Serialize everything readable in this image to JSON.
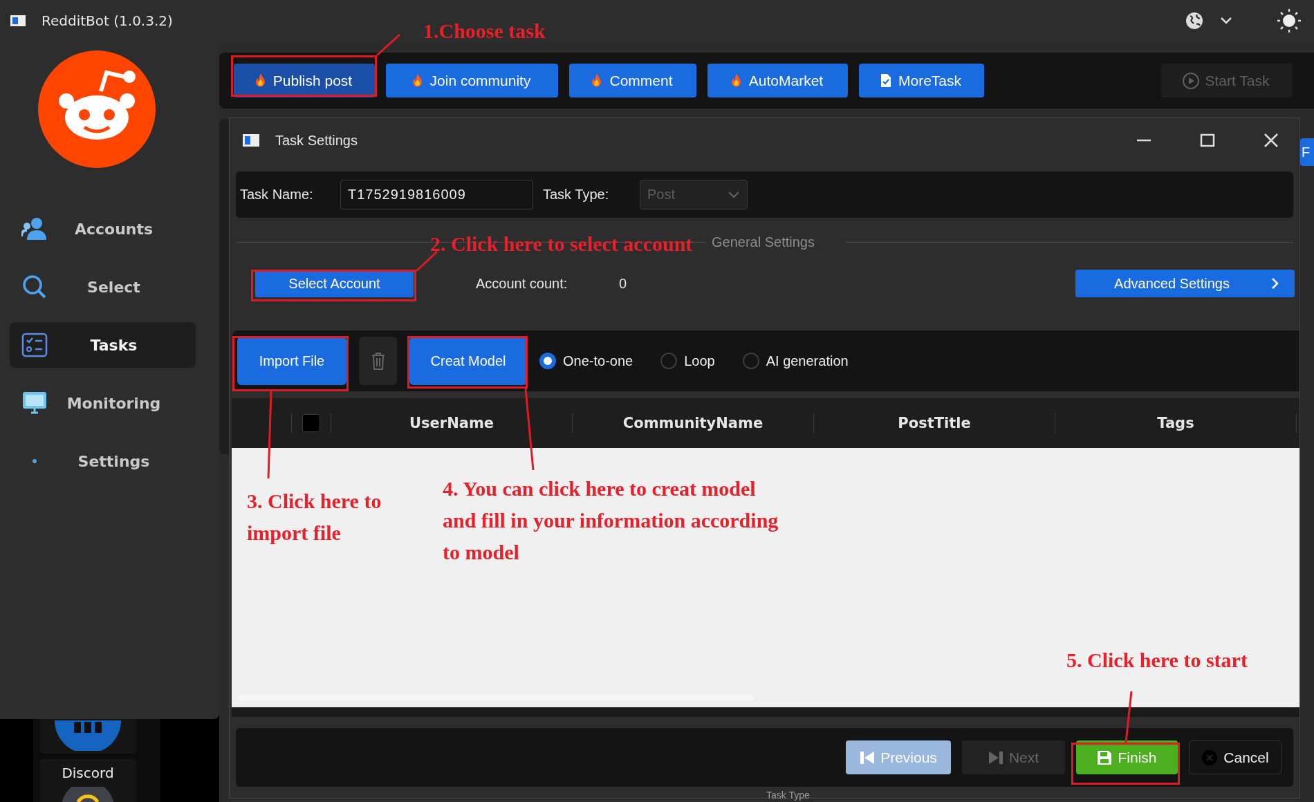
{
  "window": {
    "title": "RedditBot (1.0.3.2)"
  },
  "sidebar": {
    "items": [
      {
        "label": "Accounts",
        "selected": false
      },
      {
        "label": "Select",
        "selected": false
      },
      {
        "label": "Tasks",
        "selected": true
      },
      {
        "label": "Monitoring",
        "selected": false
      },
      {
        "label": "Settings",
        "selected": false
      }
    ]
  },
  "background_panel": {
    "discord_label": "Discord",
    "side_button": "F",
    "caption": "Task Type"
  },
  "task_toolbar": {
    "tasks": [
      {
        "label": "Publish post",
        "kind": "hot",
        "selected": true
      },
      {
        "label": "Join community",
        "kind": "hot",
        "selected": false
      },
      {
        "label": "Comment",
        "kind": "hot",
        "selected": false
      },
      {
        "label": "AutoMarket",
        "kind": "hot",
        "selected": false
      },
      {
        "label": "MoreTask",
        "kind": "doc",
        "selected": false
      }
    ],
    "start_button": {
      "label": "Start Task",
      "disabled": true
    }
  },
  "dialog": {
    "title": "Task Settings",
    "task_name_label": "Task Name:",
    "task_name": "T1752919816009",
    "task_type_label": "Task Type:",
    "task_type": {
      "value": "Post",
      "disabled": true
    },
    "section_title": "General Settings",
    "select_account": "Select Account",
    "account_count_label": "Account count:",
    "account_count": "0",
    "advanced_settings": "Advanced Settings",
    "import_file": "Import File",
    "creat_model": "Creat Model",
    "modes": [
      {
        "label": "One-to-one",
        "selected": true
      },
      {
        "label": "Loop",
        "selected": false
      },
      {
        "label": "AI generation",
        "selected": false
      }
    ],
    "table": {
      "header_checked": false,
      "columns": [
        "UserName",
        "CommunityName",
        "PostTitle",
        "Tags"
      ]
    },
    "buttons": [
      {
        "label": "Previous",
        "kind": "previous",
        "disabled": true
      },
      {
        "label": "Next",
        "kind": "next",
        "disabled": true
      },
      {
        "label": "Finish",
        "kind": "finish",
        "disabled": false
      },
      {
        "label": "Cancel",
        "kind": "cancel",
        "disabled": false
      }
    ]
  },
  "annotations": [
    {
      "lines": [
        "1.Choose task"
      ]
    },
    {
      "lines": [
        "2. Click here to select account"
      ]
    },
    {
      "lines": [
        "3. Click here to",
        "import file"
      ]
    },
    {
      "lines": [
        "4. You can click here to creat model",
        "and fill in your information according",
        "to model"
      ]
    },
    {
      "lines": [
        "5. Click here to start"
      ]
    }
  ]
}
